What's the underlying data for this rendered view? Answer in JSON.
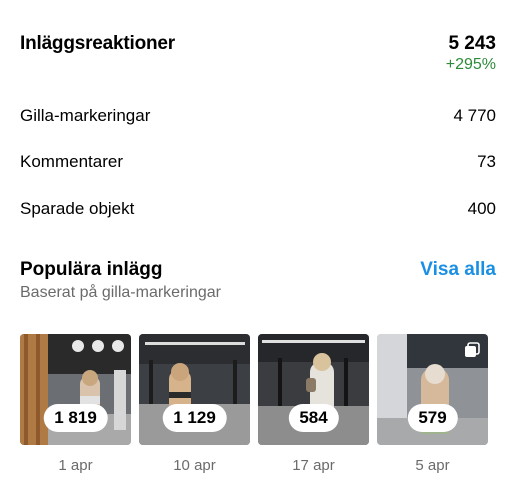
{
  "reactions": {
    "title": "Inläggsreaktioner",
    "total": "5 243",
    "change": "+295%"
  },
  "metrics": [
    {
      "label": "Gilla-markeringar",
      "value": "4 770"
    },
    {
      "label": "Kommentarer",
      "value": "73"
    },
    {
      "label": "Sparade objekt",
      "value": "400"
    }
  ],
  "popular": {
    "title": "Populära inlägg",
    "link": "Visa alla",
    "subtitle": "Baserat på gilla-markeringar",
    "posts": [
      {
        "count": "1 819",
        "date": "1 apr",
        "icon": "photo-thumbnail"
      },
      {
        "count": "1 129",
        "date": "10 apr",
        "icon": "photo-thumbnail"
      },
      {
        "count": "584",
        "date": "17 apr",
        "icon": "photo-thumbnail"
      },
      {
        "count": "579",
        "date": "5 apr",
        "icon": "carousel-icon"
      }
    ]
  },
  "colors": {
    "link": "#1a8fe3",
    "positive": "#2e8b3a",
    "muted": "#6b6b6b"
  }
}
